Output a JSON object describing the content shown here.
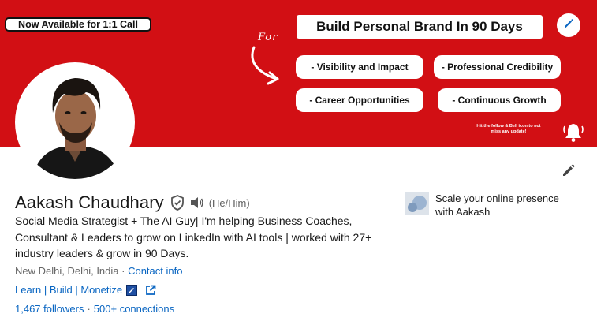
{
  "banner": {
    "availability": "Now Available for 1:1 Call",
    "title": "Build Personal Brand In 90 Days",
    "for_label": "For",
    "features": [
      "- Visibility and Impact",
      "- Professional Credibility",
      "- Career Opportunities",
      "- Continuous Growth"
    ],
    "follow_note": "Hit the follow & Bell icon to not miss any update!",
    "background_color": "#d20f14"
  },
  "profile": {
    "name": "Aakash Chaudhary",
    "pronouns": "(He/Him)",
    "headline": "Social Media Strategist + The AI Guy| I'm helping Business Coaches, Consultant & Leaders to grow on LinkedIn with AI tools | worked with 27+ industry leaders & grow in 90 Days.",
    "location": "New Delhi, Delhi, India",
    "location_separator": " · ",
    "contact_info": "Contact info",
    "website": "Learn | Build | Monetize",
    "followers": "1,467 followers",
    "connections_separator": "·",
    "connections": "500+ connections"
  },
  "current_position": {
    "text": "Scale your online presence with Aakash"
  },
  "icons": {
    "edit_cover": "pencil-icon",
    "edit_intro": "pencil-icon",
    "verified": "shield-check-icon",
    "pronunciation": "speaker-icon",
    "external_link": "external-link-icon",
    "bell": "bell-icon"
  },
  "colors": {
    "link": "#0a66c2",
    "accent_red": "#d20f14"
  }
}
